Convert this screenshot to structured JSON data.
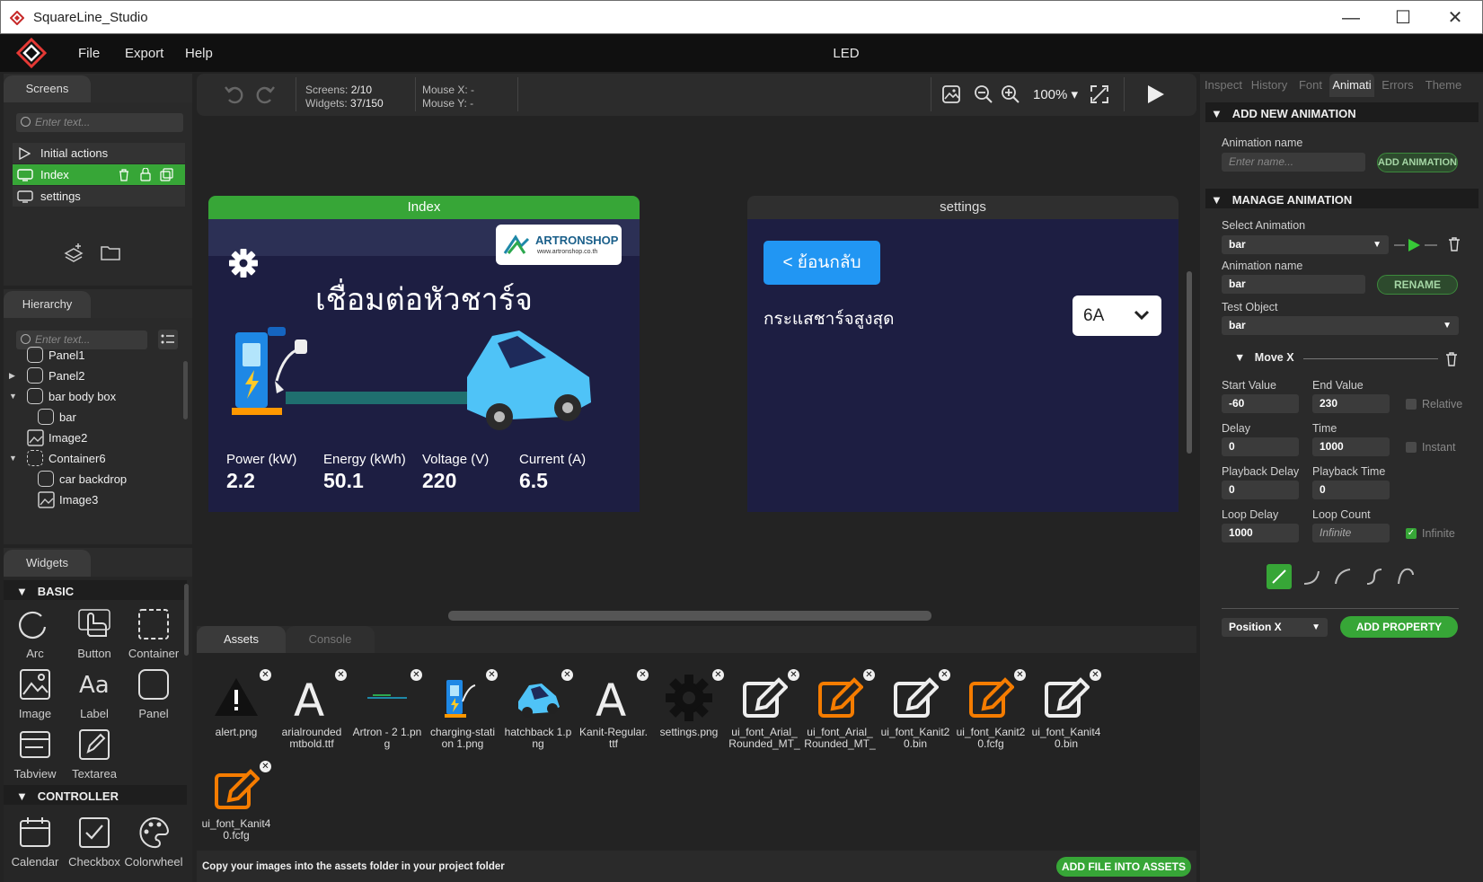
{
  "app": {
    "title": "SquareLine_Studio",
    "project": "LED"
  },
  "menu": {
    "file": "File",
    "export": "Export",
    "help": "Help"
  },
  "screens": {
    "tab": "Screens",
    "search_placeholder": "Enter text...",
    "items": [
      "Initial actions",
      "Index",
      "settings"
    ]
  },
  "hierarchy": {
    "tab": "Hierarchy",
    "search_placeholder": "Enter text...",
    "items": [
      "Panel1",
      "Panel2",
      "bar body box",
      "bar",
      "Image2",
      "Container6",
      "car backdrop",
      "Image3"
    ]
  },
  "widgets": {
    "tab": "Widgets",
    "basic_title": "BASIC",
    "basic": [
      "Arc",
      "Button",
      "Container",
      "Image",
      "Label",
      "Panel",
      "Tabview",
      "Textarea"
    ],
    "controller_title": "CONTROLLER",
    "controller": [
      "Calendar",
      "Checkbox",
      "Colorwheel"
    ]
  },
  "toolbar": {
    "screens_label": "Screens:",
    "screens_value": "2/10",
    "widgets_label": "Widgets:",
    "widgets_value": "37/150",
    "mouse_x": "Mouse X: -",
    "mouse_y": "Mouse Y: -",
    "zoom": "100%"
  },
  "canvas": {
    "index": {
      "title": "Index",
      "logo": "ARTRONSHOP",
      "logo_url": "www.artronshop.co.th",
      "heading": "เชื่อมต่อหัวชาร์จ",
      "stats": [
        {
          "label": "Power (kW)",
          "value": "2.2"
        },
        {
          "label": "Energy (kWh)",
          "value": "50.1"
        },
        {
          "label": "Voltage (V)",
          "value": "220"
        },
        {
          "label": "Current (A)",
          "value": "6.5"
        }
      ]
    },
    "settings": {
      "title": "settings",
      "back": "< ย้อนกลับ",
      "label": "กระแสชาร์จสูงสุด",
      "dropdown": "6A"
    }
  },
  "bottom": {
    "tabs": [
      "Assets",
      "Console"
    ],
    "hint": "Copy your images into the assets folder in your project folder",
    "add_file": "ADD FILE INTO ASSETS",
    "assets": [
      {
        "name": "alert.png",
        "icon": "warning-icon"
      },
      {
        "name": "arialrounded mtbold.ttf",
        "icon": "font-icon"
      },
      {
        "name": "Artron - 2 1.png",
        "icon": "logo-thumb"
      },
      {
        "name": "charging-stati on 1.png",
        "icon": "charger-icon"
      },
      {
        "name": "hatchback 1.png",
        "icon": "car-icon"
      },
      {
        "name": "Kanit-Regular. ttf",
        "icon": "font-icon"
      },
      {
        "name": "settings.png",
        "icon": "gear-icon"
      },
      {
        "name": "ui_font_Arial_ Rounded_MT_",
        "icon": "edit-icon"
      },
      {
        "name": "ui_font_Arial_ Rounded_MT_",
        "icon": "edit-icon-orange"
      },
      {
        "name": "ui_font_Kanit2 0.bin",
        "icon": "edit-icon"
      },
      {
        "name": "ui_font_Kanit2 0.fcfg",
        "icon": "edit-icon-orange"
      },
      {
        "name": "ui_font_Kanit4 0.bin",
        "icon": "edit-icon"
      },
      {
        "name": "ui_font_Kanit4 0.fcfg",
        "icon": "edit-icon-orange"
      }
    ]
  },
  "right": {
    "tabs": [
      "Inspect",
      "History",
      "Font",
      "Animati",
      "Errors",
      "Theme"
    ],
    "add": {
      "title": "ADD NEW ANIMATION",
      "name_label": "Animation name",
      "name_placeholder": "Enter name...",
      "button": "ADD ANIMATION"
    },
    "manage": {
      "title": "MANAGE ANIMATION",
      "select_label": "Select Animation",
      "select_value": "bar",
      "name_label": "Animation name",
      "name_value": "bar",
      "rename": "RENAME",
      "test_label": "Test Object",
      "test_value": "bar",
      "move_x": "Move X",
      "start_label": "Start Value",
      "start_value": "-60",
      "end_label": "End Value",
      "end_value": "230",
      "relative": "Relative",
      "delay_label": "Delay",
      "delay_value": "0",
      "time_label": "Time",
      "time_value": "1000",
      "instant": "Instant",
      "pdelay_label": "Playback Delay",
      "pdelay_value": "0",
      "ptime_label": "Playback Time",
      "ptime_value": "0",
      "ldelay_label": "Loop Delay",
      "ldelay_value": "1000",
      "lcount_label": "Loop Count",
      "lcount_value": "Infinite",
      "infinite": "Infinite",
      "prop_value": "Position X",
      "add_property": "ADD PROPERTY"
    }
  },
  "colors": {
    "accent_green": "#37a637",
    "screen_bg": "#1d1e42",
    "button_blue": "#2196f3"
  }
}
